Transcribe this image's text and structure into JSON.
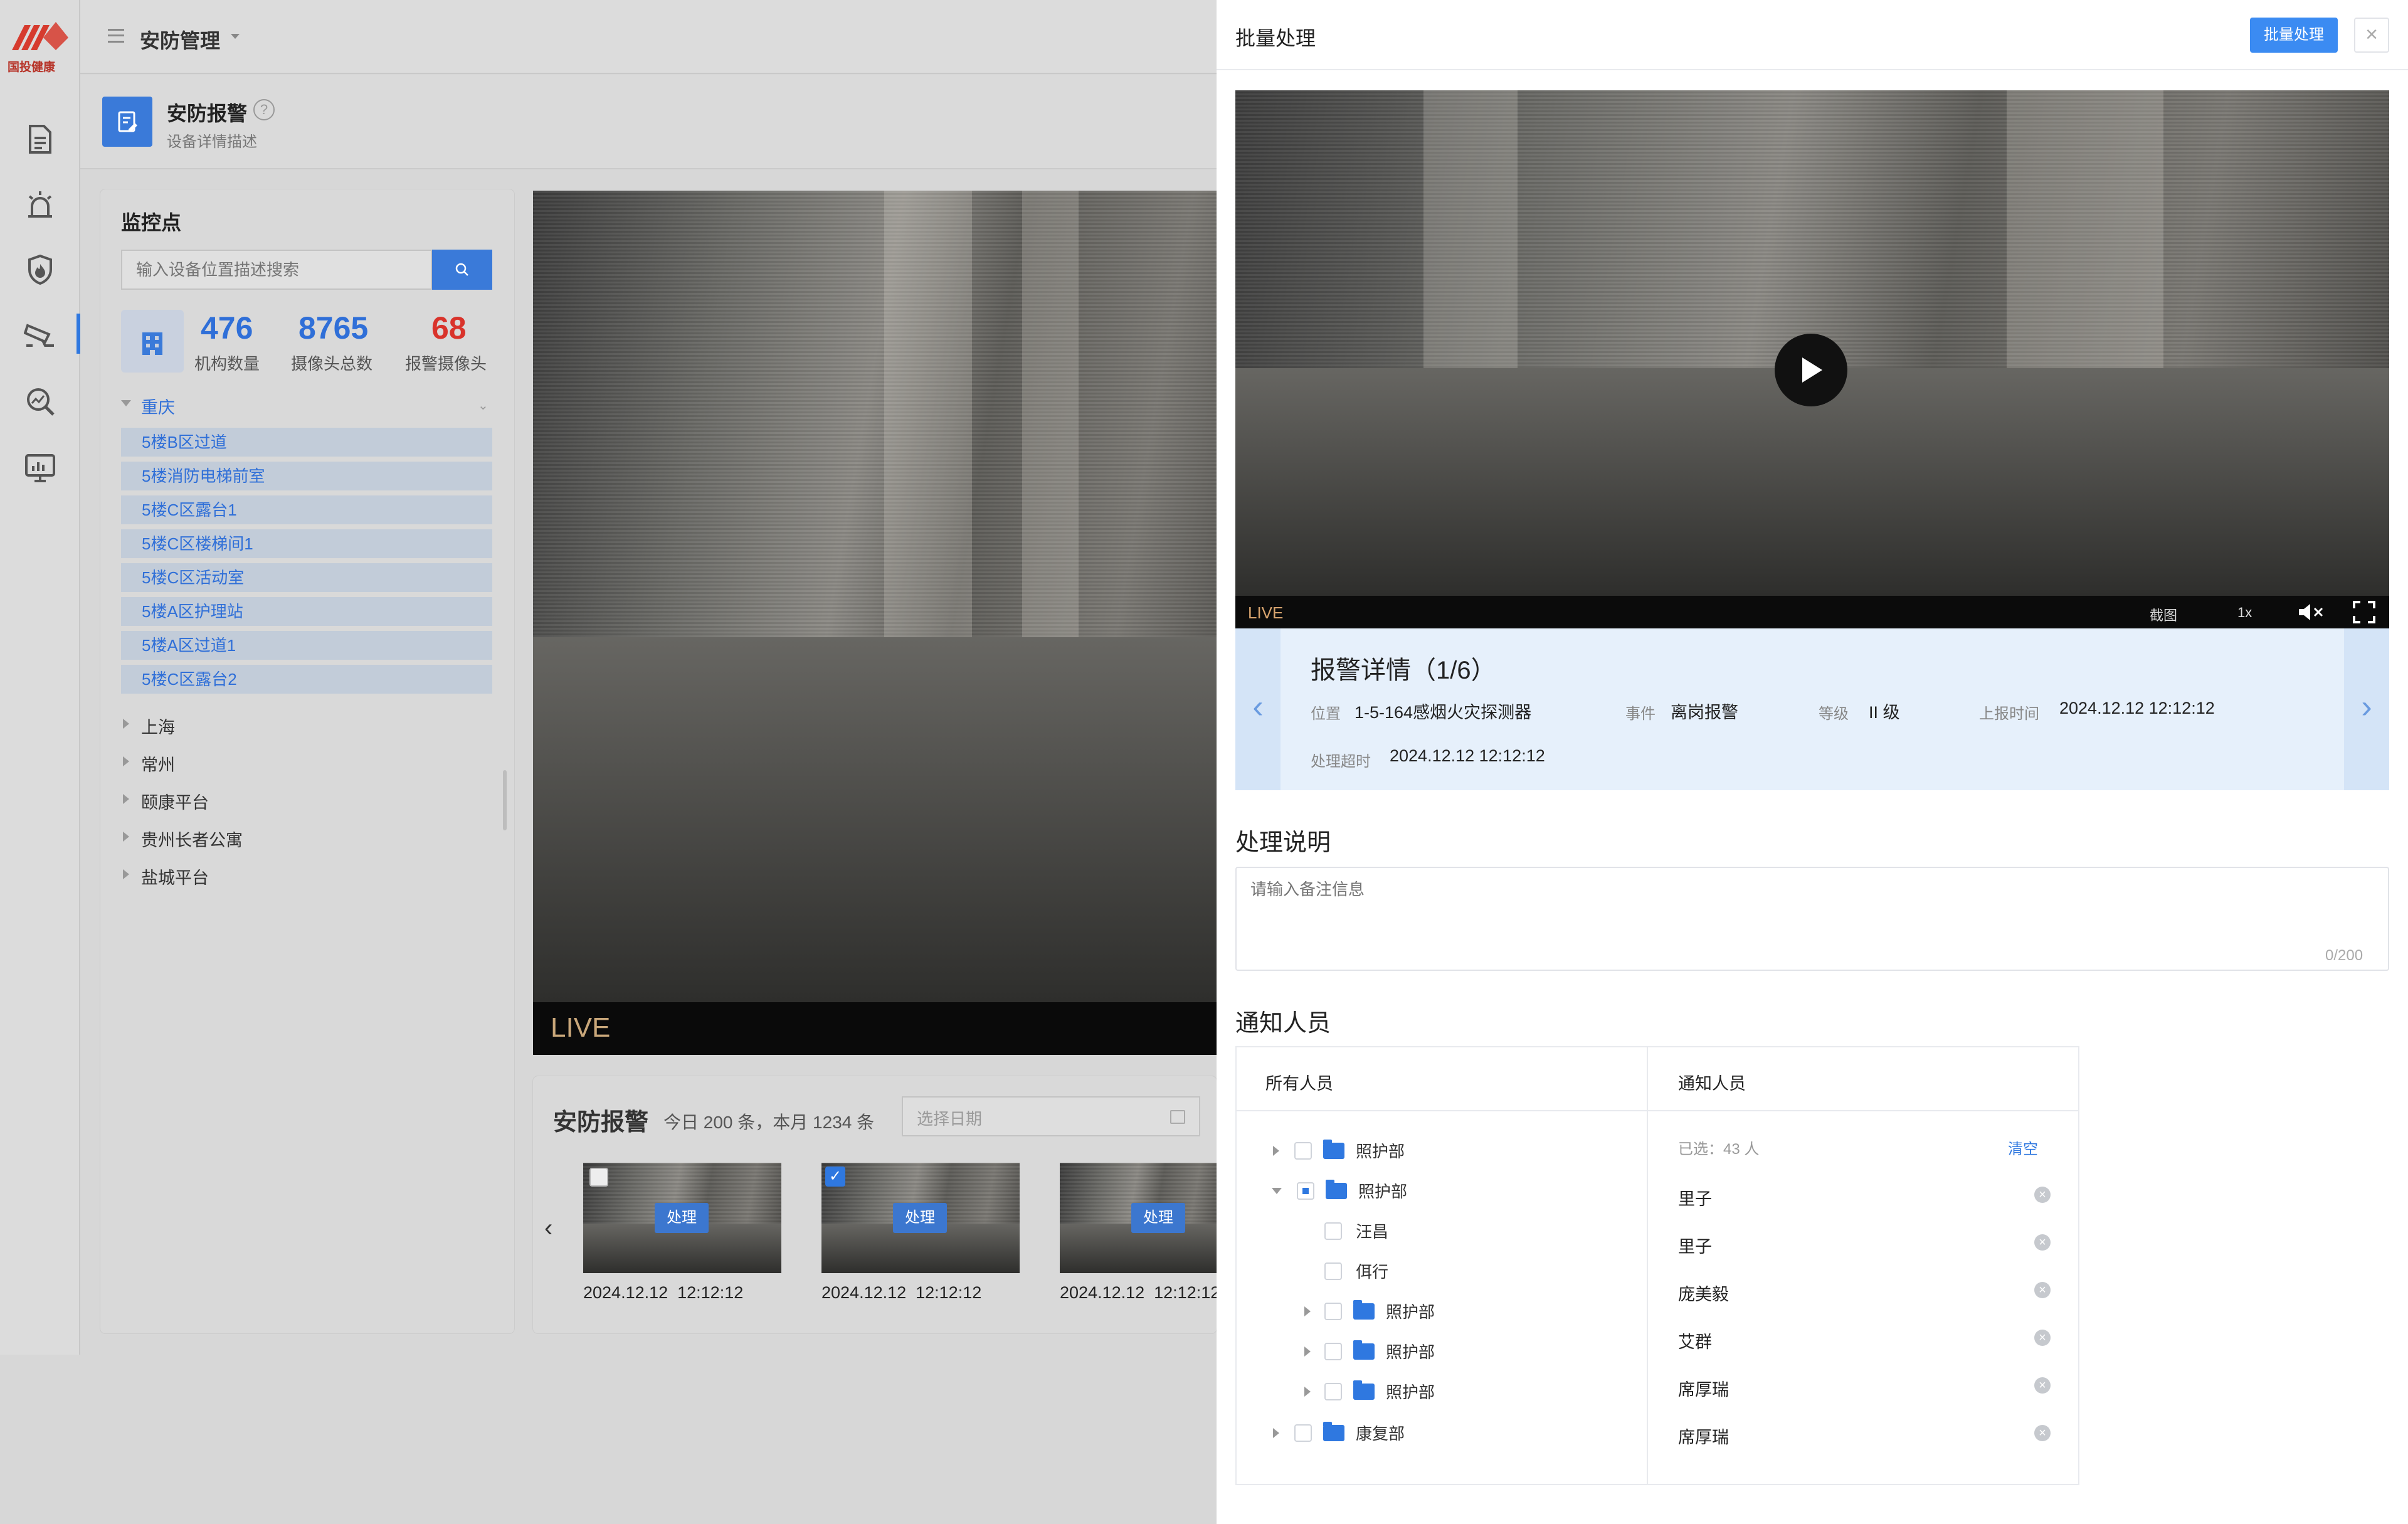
{
  "brand": {
    "logo_text": "国投健康"
  },
  "header": {
    "title": "安防管理"
  },
  "page": {
    "title": "安防报警",
    "subtitle": "设备详情描述"
  },
  "sidebar_nav": [
    {
      "name": "document-icon"
    },
    {
      "name": "alarm-icon"
    },
    {
      "name": "fire-shield-icon"
    },
    {
      "name": "camera-icon"
    },
    {
      "name": "search-analytics-icon"
    },
    {
      "name": "monitor-chart-icon"
    }
  ],
  "monitor": {
    "title": "监控点",
    "search_placeholder": "输入设备位置描述搜索",
    "stats": [
      {
        "value": "476",
        "label": "机构数量",
        "color": "#2f6fd8"
      },
      {
        "value": "8765",
        "label": "摄像头总数",
        "color": "#2f6fd8"
      },
      {
        "value": "68",
        "label": "报警摄像头",
        "color": "#d9332b"
      }
    ],
    "region_open": "重庆",
    "locations": [
      "5楼B区过道",
      "5楼消防电梯前室",
      "5楼C区露台1",
      "5楼C区楼梯间1",
      "5楼C区活动室",
      "5楼A区护理站",
      "5楼A区过道1",
      "5楼C区露台2"
    ],
    "regions": [
      "上海",
      "常州",
      "颐康平台",
      "贵州长者公寓",
      "盐城平台"
    ]
  },
  "video_main": {
    "live": "LIVE"
  },
  "alarms": {
    "title": "安防报警",
    "summary": "今日 200 条，本月 1234 条",
    "date_placeholder": "选择日期",
    "thumbs": [
      {
        "btn": "处理",
        "time": "2024.12.12  12:12:12",
        "checked": false
      },
      {
        "btn": "处理",
        "time": "2024.12.12  12:12:12",
        "checked": true
      },
      {
        "btn": "处理",
        "time": "2024.12.12  12:12:12",
        "checked": false
      }
    ]
  },
  "panel": {
    "title": "批量处理",
    "batch_btn": "批量处理",
    "close": "×",
    "video": {
      "live": "LIVE",
      "screenshot": "截图",
      "speed": "1x"
    },
    "detail": {
      "title": "报警详情（1/6）",
      "location_label": "位置",
      "location": "1-5-164感烟火灾探测器",
      "event_label": "事件",
      "event": "离岗报警",
      "level_label": "等级",
      "level": "II 级",
      "report_label": "上报时间",
      "report": "2024.12.12 12:12:12",
      "timeout_label": "处理超时",
      "timeout": "2024.12.12 12:12:12"
    },
    "remark": {
      "title": "处理说明",
      "placeholder": "请输入备注信息",
      "count": "0/200"
    },
    "notify": {
      "title": "通知人员",
      "all_header": "所有人员",
      "selected_header": "通知人员",
      "selected_count": "已选：43 人",
      "clear": "清空",
      "tree": [
        {
          "label": "照护部",
          "type": "folder",
          "level": 0,
          "expanded": false,
          "state": "none"
        },
        {
          "label": "照护部",
          "type": "folder",
          "level": 0,
          "expanded": true,
          "state": "partial"
        },
        {
          "label": "汪昌",
          "type": "person",
          "level": 1
        },
        {
          "label": "佴行",
          "type": "person",
          "level": 1
        },
        {
          "label": "照护部",
          "type": "folder",
          "level": 1,
          "expanded": false,
          "state": "none"
        },
        {
          "label": "照护部",
          "type": "folder",
          "level": 1,
          "expanded": false,
          "state": "none"
        },
        {
          "label": "照护部",
          "type": "folder",
          "level": 1,
          "expanded": false,
          "state": "none"
        },
        {
          "label": "康复部",
          "type": "folder",
          "level": 0,
          "expanded": false,
          "state": "none"
        }
      ],
      "selected": [
        "里子",
        "里子",
        "庞美毅",
        "艾群",
        "席厚瑞",
        "席厚瑞"
      ]
    }
  },
  "colors": {
    "primary": "#2f78e0",
    "danger": "#d9332b",
    "panel_bg": "#ffffff",
    "overlay": "#d7d7d7"
  }
}
